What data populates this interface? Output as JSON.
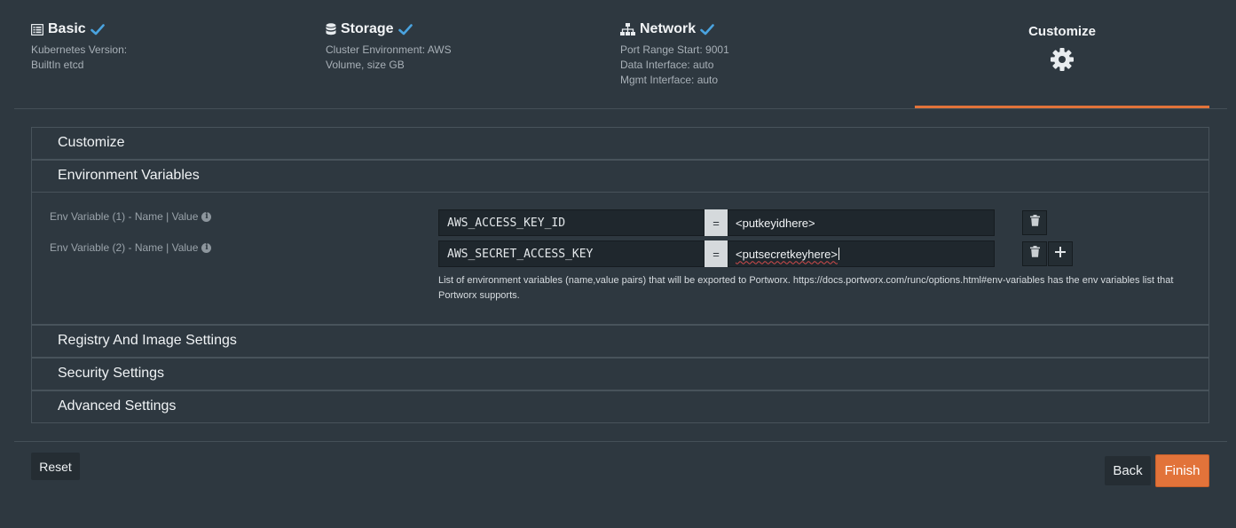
{
  "steps": {
    "basic": {
      "title": "Basic",
      "lines": [
        "Kubernetes Version:",
        "BuiltIn etcd"
      ],
      "icon": "list-icon",
      "status": "check-icon"
    },
    "storage": {
      "title": "Storage",
      "lines": [
        "Cluster Environment: AWS",
        "Volume, size GB"
      ],
      "icon": "database-icon",
      "status": "check-icon"
    },
    "network": {
      "title": "Network",
      "lines": [
        "Port Range Start: 9001",
        "Data Interface: auto",
        "Mgmt Interface: auto"
      ],
      "icon": "sitemap-icon",
      "status": "check-icon"
    },
    "customize": {
      "title": "Customize",
      "icon": "gear-icon",
      "active": true
    }
  },
  "panels": {
    "customize": "Customize",
    "env": "Environment Variables",
    "registry": "Registry And Image Settings",
    "security": "Security Settings",
    "advanced": "Advanced Settings"
  },
  "env": {
    "rows": [
      {
        "label": "Env Variable (1) - Name | Value",
        "name": "AWS_ACCESS_KEY_ID",
        "eq": "=",
        "value": "<putkeyidhere>"
      },
      {
        "label": "Env Variable (2) - Name | Value",
        "name": "AWS_SECRET_ACCESS_KEY",
        "eq": "=",
        "value": "<putsecretkeyhere>"
      }
    ],
    "help": "List of environment variables (name,value pairs) that will be exported to Portworx. https://docs.portworx.com/runc/options.html#env-variables has the env variables list that Portworx supports."
  },
  "buttons": {
    "reset": "Reset",
    "back": "Back",
    "finish": "Finish"
  },
  "colors": {
    "accent": "#e2733a",
    "check": "#4aa3df",
    "background": "#2e3840"
  }
}
